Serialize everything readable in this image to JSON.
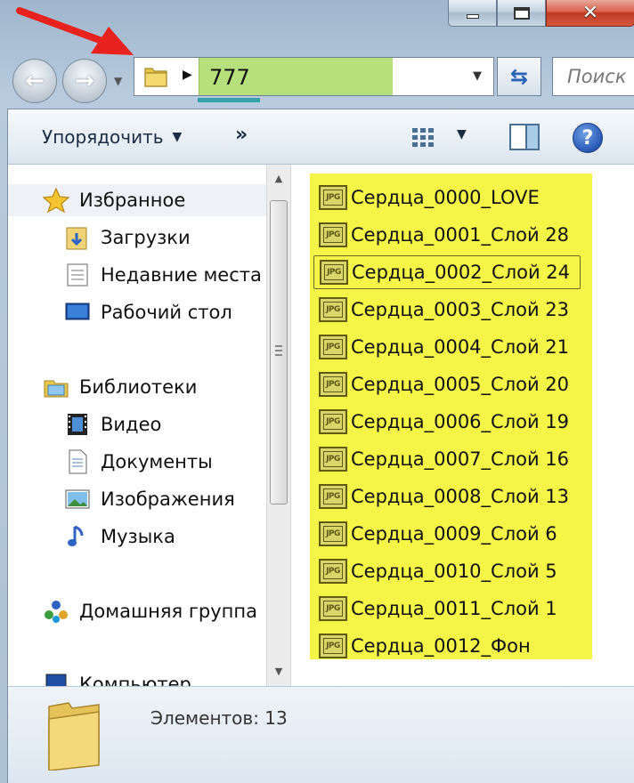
{
  "window": {
    "buttons": {
      "minimize_icon": "minimize-icon",
      "maximize_icon": "maximize-icon",
      "close_glyph": "✕"
    }
  },
  "address_bar": {
    "path": "777",
    "separator": "▶",
    "highlight_color": "#b6e07c"
  },
  "search": {
    "placeholder": "Поиск"
  },
  "toolbar": {
    "organize_label": "Упорядочить",
    "organize_caret": "▼",
    "more_label": "»",
    "views_caret": "▼",
    "help_label": "?"
  },
  "navigation": {
    "favorites_label": "Избранное",
    "favorites": [
      {
        "label": "Загрузки",
        "icon": "downloads-folder-icon"
      },
      {
        "label": "Недавние места",
        "icon": "recent-places-icon"
      },
      {
        "label": "Рабочий стол",
        "icon": "desktop-icon"
      }
    ],
    "libraries_label": "Библиотеки",
    "libraries": [
      {
        "label": "Видео",
        "icon": "video-library-icon"
      },
      {
        "label": "Документы",
        "icon": "documents-library-icon"
      },
      {
        "label": "Изображения",
        "icon": "pictures-library-icon"
      },
      {
        "label": "Музыка",
        "icon": "music-library-icon"
      }
    ],
    "homegroup_label": "Домашняя группа",
    "computer_label": "Компьютер"
  },
  "files": {
    "highlight_color": "#f5f547",
    "icon_label": "JPG",
    "items": [
      "Сердца_0000_LOVE",
      "Сердца_0001_Слой 28",
      "Сердца_0002_Слой 24",
      "Сердца_0003_Слой 23",
      "Сердца_0004_Слой 21",
      "Сердца_0005_Слой 20",
      "Сердца_0006_Слой 19",
      "Сердца_0007_Слой 16",
      "Сердца_0008_Слой 13",
      "Сердца_0009_Слой 6",
      "Сердца_0010_Слой 5",
      "Сердца_0011_Слой 1",
      "Сердца_0012_Фон"
    ]
  },
  "status": {
    "count_text": "Элементов: 13"
  },
  "annotation": {
    "arrow_color": "#e8231f"
  }
}
